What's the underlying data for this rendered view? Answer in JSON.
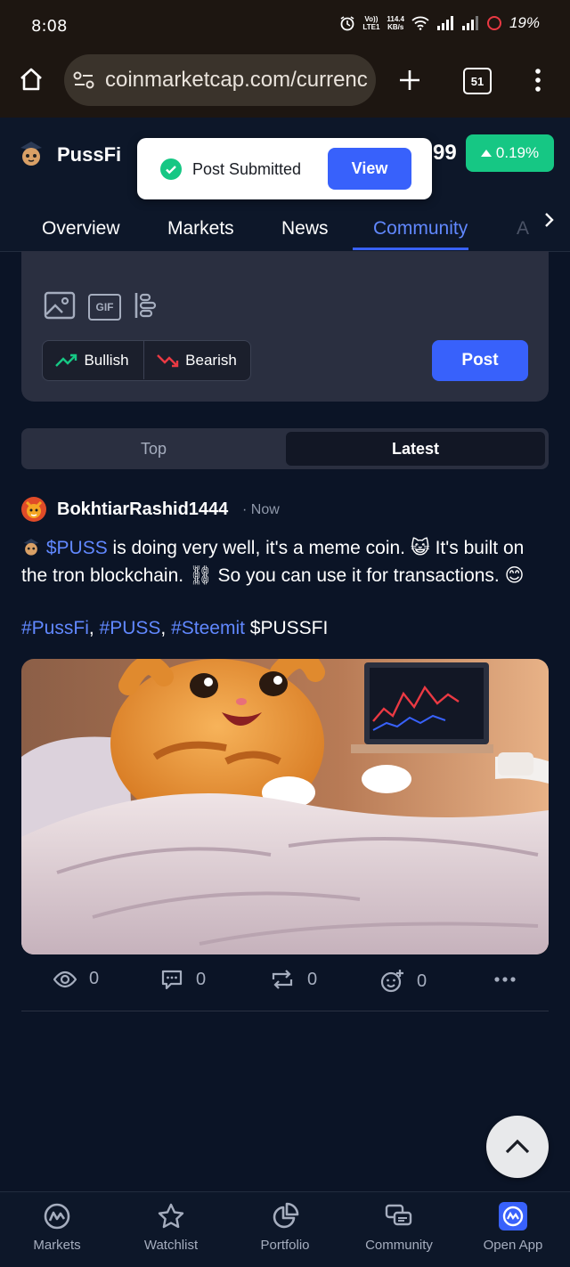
{
  "status_bar": {
    "time": "8:08",
    "net_speed_top": "114.4",
    "net_speed_bottom": "KB/s",
    "volte_top": "Vo))",
    "volte_bottom": "LTE1",
    "battery": "19%"
  },
  "browser": {
    "url": "coinmarketcap.com/currenc",
    "tab_count": "51"
  },
  "coin": {
    "name": "PussFi",
    "price_fragment": "99",
    "change": "0.19%",
    "change_color": "#16c784"
  },
  "toast": {
    "message": "Post Submitted",
    "view_label": "View"
  },
  "tabs": [
    {
      "label": "Overview"
    },
    {
      "label": "Markets"
    },
    {
      "label": "News"
    },
    {
      "label": "Community"
    },
    {
      "label": "A"
    }
  ],
  "composer": {
    "gif_label": "GIF",
    "bullish_label": "Bullish",
    "bearish_label": "Bearish",
    "post_label": "Post"
  },
  "feed_toggle": {
    "top_label": "Top",
    "latest_label": "Latest",
    "selected": "Latest"
  },
  "post": {
    "username": "BokhtiarRashid1444",
    "time": "· Now",
    "coin_link": "$PUSS",
    "text_1": " is doing very well, it's a meme coin. 😺 It's built on the tron blockchain. ⛓ So you can use it for transactions. 😊",
    "hashtags": [
      "#PussFi",
      "#PUSS",
      "#Steemit"
    ],
    "ticker": "$PUSSFI",
    "views": "0",
    "comments": "0",
    "reposts": "0",
    "reactions": "0"
  },
  "bottom_nav": [
    {
      "label": "Markets",
      "icon": "coinmarketcap-icon"
    },
    {
      "label": "Watchlist",
      "icon": "star-icon"
    },
    {
      "label": "Portfolio",
      "icon": "pie-chart-icon"
    },
    {
      "label": "Community",
      "icon": "chat-bubbles-icon"
    },
    {
      "label": "Open App",
      "icon": "app-logo-icon"
    }
  ],
  "colors": {
    "accent": "#3861fb",
    "link": "#6188ff",
    "positive": "#16c784",
    "negative": "#ea3943",
    "background": "#0b1426"
  }
}
